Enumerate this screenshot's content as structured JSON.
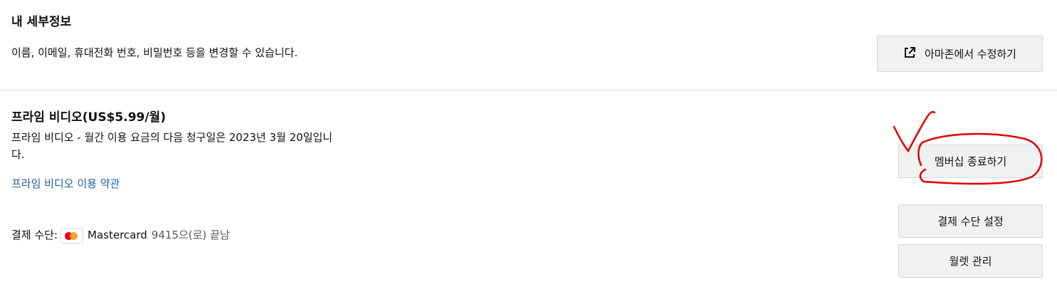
{
  "details": {
    "title": "내 세부정보",
    "description": "이름, 이메일, 휴대전화 번호, 비밀번호 등을 변경할 수 있습니다.",
    "edit_button": "아마존에서 수정하기",
    "edit_icon": "external-link-icon"
  },
  "prime": {
    "title": "프라임 비디오(US$5.99/월)",
    "billing_line1": "프라임 비디오 - 월간 이용 요금의 다음 청구일은 2023년 3월 20일입니",
    "billing_line2": "다.",
    "terms_link": "프라임 비디오 이용 약관",
    "end_membership_button": "멤버십 종료하기",
    "payment_label": "결제 수단:",
    "card_brand": "Mastercard",
    "card_suffix": "9415으(로) 끝남",
    "card_icon": "mastercard-icon",
    "payment_settings_button": "결제 수단 설정",
    "wallet_button": "월렛 관리"
  },
  "colors": {
    "link": "#2162a1",
    "button_bg": "#f0f2f2",
    "annotation_red": "#e00000",
    "mastercard_red": "#eb001b",
    "mastercard_orange": "#f79e1b"
  }
}
